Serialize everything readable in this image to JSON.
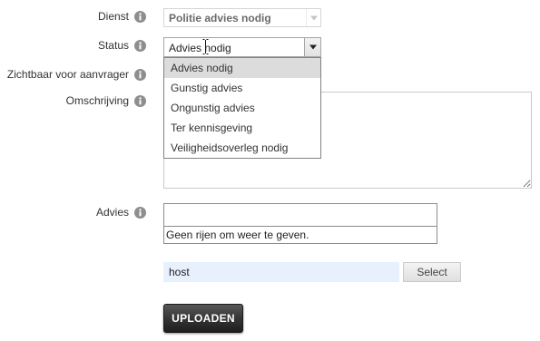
{
  "fields": {
    "dienst": {
      "label": "Dienst",
      "value": "Politie advies nodig"
    },
    "status": {
      "label": "Status",
      "value": "Advies nodig",
      "dropdown_open": true,
      "options": [
        {
          "label": "Advies nodig",
          "highlighted": true
        },
        {
          "label": "Gunstig advies",
          "highlighted": false
        },
        {
          "label": "Ongunstig advies",
          "highlighted": false
        },
        {
          "label": "Ter kennisgeving",
          "highlighted": false
        },
        {
          "label": "Veiligheidsoverleg nodig",
          "highlighted": false
        }
      ]
    },
    "zichtbaar": {
      "label": "Zichtbaar voor aanvrager"
    },
    "omschrijving": {
      "label": "Omschrijving",
      "value": ""
    },
    "advies": {
      "label": "Advies",
      "empty_message": "Geen rijen om weer te geven."
    }
  },
  "upload": {
    "file_name": "host",
    "select_label": "Select",
    "upload_label": "UPLOADEN"
  },
  "icons": {
    "info": "info-icon",
    "dropdown_arrow": "chevron-down-icon",
    "mouse_cursor": "text-cursor-icon"
  },
  "colors": {
    "option_highlight": "#dcdcdc",
    "file_input_bg": "#e8f0fe",
    "upload_button": "#333333"
  }
}
